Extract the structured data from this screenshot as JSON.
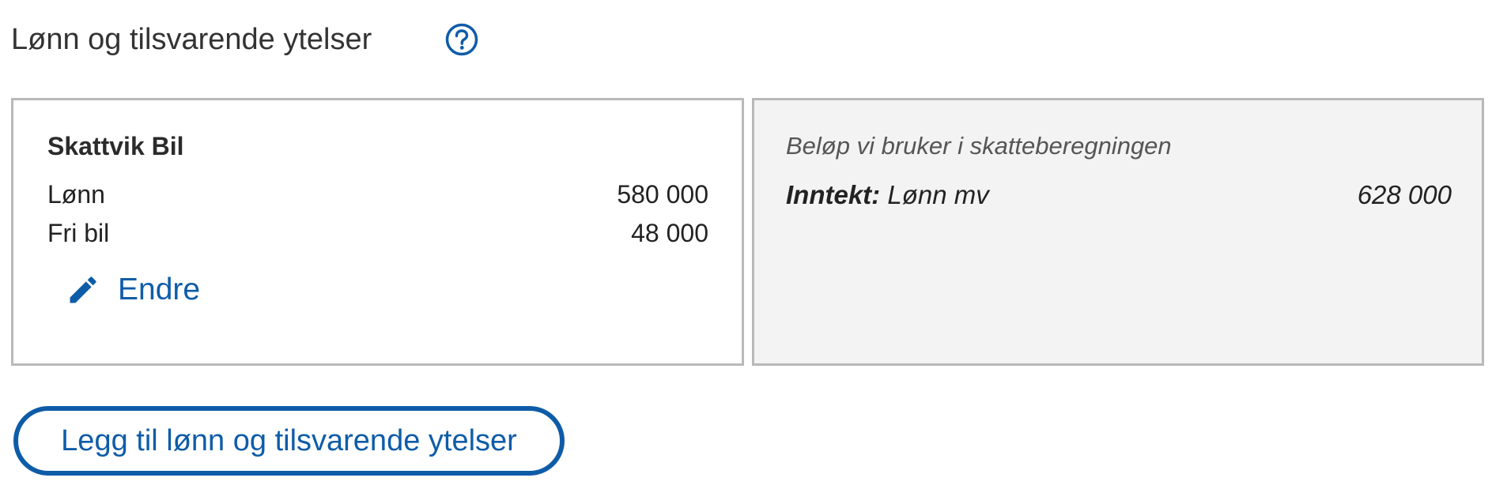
{
  "section": {
    "title": "Lønn og tilsvarende ytelser",
    "help_icon": "question-circle-icon"
  },
  "employer_card": {
    "name": "Skattvik Bil",
    "rows": [
      {
        "label": "Lønn",
        "value": "580 000"
      },
      {
        "label": "Fri bil",
        "value": "48 000"
      }
    ],
    "edit_label": "Endre",
    "edit_icon": "pencil-icon"
  },
  "tax_card": {
    "caption": "Beløp vi bruker i skatteberegningen",
    "income_label": "Inntekt:",
    "income_type": "Lønn mv",
    "income_value": "628 000"
  },
  "add_button": {
    "label": "Legg til lønn og tilsvarende ytelser"
  },
  "colors": {
    "accent": "#0e5ca8",
    "border": "#b9b9b9",
    "panel_background": "#f3f3f3"
  }
}
